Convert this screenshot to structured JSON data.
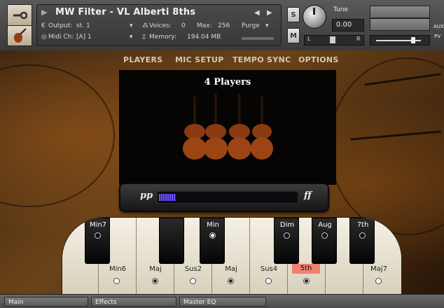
{
  "header": {
    "instrument_title": "MW Filter - VL Alberti 8ths",
    "output_label": "Output:",
    "output_value": "st. 1",
    "voices_label": "Voices:",
    "voices_value": "0",
    "max_label": "Max:",
    "max_value": "256",
    "purge_label": "Purge",
    "midi_label": "Midi Ch:",
    "midi_value": "[A] 1",
    "memory_label": "Memory:",
    "memory_value": "194.04 MB",
    "solo_label": "S",
    "mute_label": "M",
    "tune_label": "Tune",
    "tune_value": "0.00",
    "pan_left": "L",
    "pan_right": "R",
    "aux_label": "AUX",
    "pv_label": "PV"
  },
  "tabs": [
    {
      "label": "PLAYERS",
      "active": true
    },
    {
      "label": "MIC SETUP",
      "active": false
    },
    {
      "label": "TEMPO SYNC",
      "active": false
    },
    {
      "label": "OPTIONS",
      "active": false
    }
  ],
  "players": {
    "title": "4 Players",
    "count": 4
  },
  "dynamics": {
    "low_label": "pp",
    "high_label": "ff",
    "level": 0.12
  },
  "keyboard": {
    "white_keys": [
      {
        "label": "Min6",
        "selected": false,
        "highlight": false
      },
      {
        "label": "Maj",
        "selected": true,
        "highlight": false
      },
      {
        "label": "Sus2",
        "selected": false,
        "highlight": false
      },
      {
        "label": "Maj",
        "selected": true,
        "highlight": false
      },
      {
        "label": "Sus4",
        "selected": false,
        "highlight": false
      },
      {
        "label": "5th",
        "selected": true,
        "highlight": true
      },
      {
        "label": "Maj7",
        "selected": false,
        "highlight": false
      }
    ],
    "black_keys": [
      {
        "label": "Min7",
        "selected": false
      },
      {
        "label": "",
        "selected": false
      },
      {
        "label": "Min",
        "selected": true
      },
      {
        "label": "Dim",
        "selected": false
      },
      {
        "label": "Aug",
        "selected": false
      },
      {
        "label": "7th",
        "selected": false
      }
    ]
  },
  "bottom_tabs": [
    {
      "label": "Main"
    },
    {
      "label": "Effects"
    },
    {
      "label": "Master EQ"
    }
  ],
  "colors": {
    "highlight": "#f08070",
    "meter_fill": "#6a50ff"
  }
}
